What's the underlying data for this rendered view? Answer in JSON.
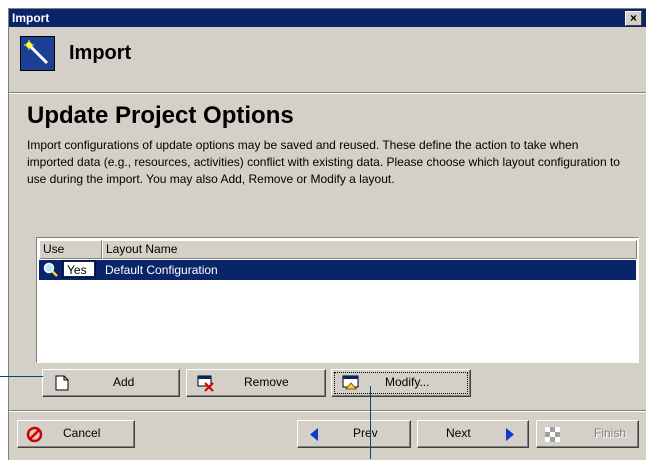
{
  "window": {
    "title": "Import",
    "close_glyph": "×"
  },
  "header": {
    "title": "Import",
    "icon": "magic-wand-icon"
  },
  "panel": {
    "title": "Update Project Options",
    "description": "Import configurations of update options may be saved and reused.  These define the action to take when imported data (e.g., resources, activities) conflict with existing data.  Please choose which layout configuration to use during the import. You may also Add, Remove or Modify a layout."
  },
  "table": {
    "columns": [
      "Use",
      "Layout Name"
    ],
    "rows": [
      {
        "use": "Yes",
        "layout_name": "Default Configuration",
        "selected": true
      }
    ]
  },
  "layout_buttons": {
    "add": "Add",
    "remove": "Remove",
    "modify": "Modify..."
  },
  "nav_buttons": {
    "cancel": "Cancel",
    "prev": "Prev",
    "next": "Next",
    "finish": "Finish"
  },
  "colors": {
    "titlebar": "#0a246a",
    "face": "#d4d0c8",
    "selection": "#0a246a",
    "annotation": "#004a7c"
  }
}
